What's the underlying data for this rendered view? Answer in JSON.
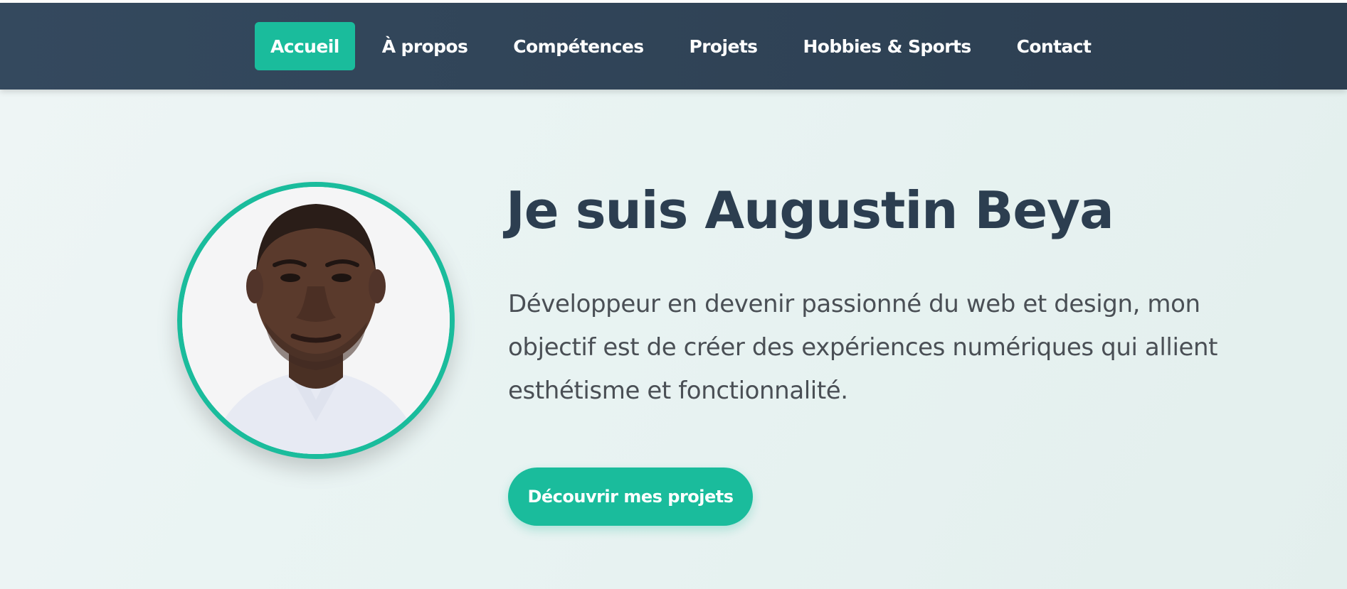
{
  "nav": {
    "items": [
      {
        "label": "Accueil",
        "active": true
      },
      {
        "label": "À propos",
        "active": false
      },
      {
        "label": "Compétences",
        "active": false
      },
      {
        "label": "Projets",
        "active": false
      },
      {
        "label": "Hobbies & Sports",
        "active": false
      },
      {
        "label": "Contact",
        "active": false
      }
    ]
  },
  "hero": {
    "title": "Je suis Augustin Beya",
    "description": "Développeur en devenir passionné du web et design, mon objectif est de créer des expériences numériques qui allient esthétisme et fonctionnalité.",
    "cta_label": "Découvrir mes projets",
    "avatar_icon": "profile-photo"
  },
  "colors": {
    "accent": "#1abc9c",
    "nav_bg": "#2c3e50",
    "title": "#2c3e50",
    "text": "#4a4f55",
    "hero_bg": "#eaf4f3"
  }
}
